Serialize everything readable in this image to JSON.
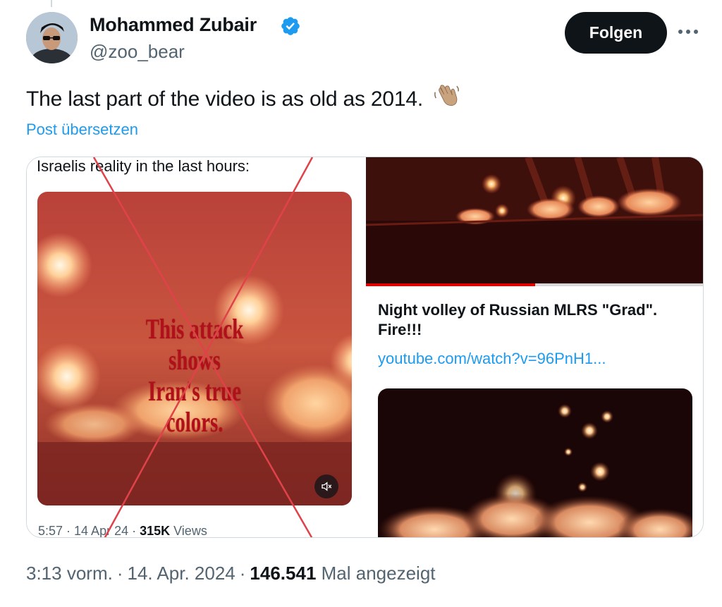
{
  "author": {
    "name": "Mohammed Zubair",
    "handle": "@zoo_bear"
  },
  "actions": {
    "follow_label": "Folgen"
  },
  "tweet": {
    "text": "The last part of the video is as old as 2014.",
    "translate_label": "Post übersetzen"
  },
  "quoted_left": {
    "caption": "Israelis reality in the last hours:",
    "overlay_line1": "This attack shows",
    "overlay_line2": "Iran's true colors.",
    "meta_time": "5:57 · 14 Apr 24 · ",
    "meta_views_count": "315K",
    "meta_views_label": " Views"
  },
  "quoted_right": {
    "card_title": "Night volley of Russian MLRS \"Grad\". Fire!!!",
    "card_link": "youtube.com/watch?v=96PnH1...",
    "progress": 0.5
  },
  "footer": {
    "time": "3:13 vorm.",
    "separator": "·",
    "date": "14. Apr. 2024",
    "views_count": "146.541",
    "views_label": "Mal angezeigt"
  },
  "colors": {
    "link": "#1d9bf0",
    "muted": "#536471",
    "follow_bg": "#0f1419",
    "cross": "#e0424a"
  },
  "icons": {
    "verified": "verified-badge-icon",
    "more": "more-options-icon",
    "wave": "waving-hand-icon",
    "mute": "mute-speaker-icon"
  }
}
